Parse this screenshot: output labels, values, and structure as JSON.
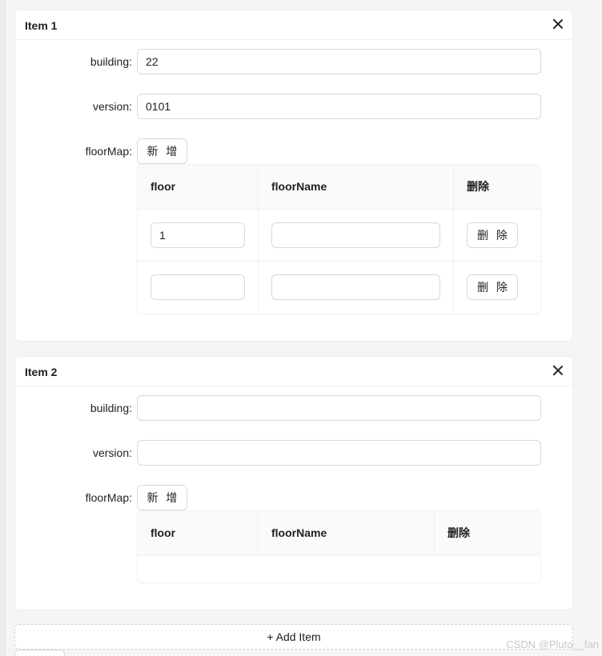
{
  "items": [
    {
      "title": "Item 1",
      "fields": {
        "building_label": "building:",
        "building_value": "22",
        "version_label": "version:",
        "version_value": "0101",
        "floormap_label": "floorMap:"
      },
      "add_button_label": "新 增",
      "table": {
        "columns": [
          "floor",
          "floorName",
          "删除"
        ],
        "rows": [
          {
            "floor": "1",
            "floorName": "",
            "delete_label": "删 除"
          },
          {
            "floor": "",
            "floorName": "",
            "delete_label": "删 除"
          }
        ]
      }
    },
    {
      "title": "Item 2",
      "fields": {
        "building_label": "building:",
        "building_value": "",
        "version_label": "version:",
        "version_value": "",
        "floormap_label": "floorMap:"
      },
      "add_button_label": "新 增",
      "table": {
        "columns": [
          "floor",
          "floorName",
          "删除"
        ],
        "rows": []
      }
    }
  ],
  "add_item_label": "+ Add Item",
  "watermark": "CSDN @Pluto__fan"
}
